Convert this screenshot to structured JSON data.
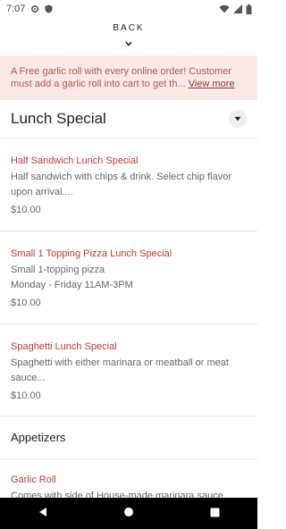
{
  "status": {
    "time": "7:07"
  },
  "header": {
    "back_label": "BACK"
  },
  "promo": {
    "text": "A Free garlic roll with every online order! Customer must add a garlic roll into cart to get th...",
    "more_label": "View more"
  },
  "section": {
    "title": "Lunch Special"
  },
  "items": [
    {
      "name": "Half Sandwich Lunch Special",
      "desc_lines": [
        "Half sandwich with chips & drink. Select chip flavor",
        "upon arrival...."
      ],
      "price": "$10.00"
    },
    {
      "name": "Small 1 Topping Pizza Lunch Special",
      "desc_lines": [
        "Small 1-topping pizza",
        "Monday - Friday 11AM-3PM"
      ],
      "price": "$10.00"
    },
    {
      "name": "Spaghetti Lunch Special",
      "desc_lines": [
        "Spaghetti with either marinara or meatball or meat",
        "sauce..."
      ],
      "price": "$10.00"
    }
  ],
  "category2": {
    "title": "Appetizers"
  },
  "partial_item": {
    "name": "Garlic Roll",
    "desc": "Comes with side of House-made marinara sauce"
  },
  "icons": {
    "status_left": [
      "settings-icon",
      "shield-icon"
    ],
    "status_right": [
      "wifi-icon",
      "signal-icon",
      "battery-icon"
    ],
    "nav": [
      "back-triangle-icon",
      "home-circle-icon",
      "recents-square-icon"
    ]
  },
  "colors": {
    "accent_red": "#c3392b",
    "promo_bg": "#fbe9e7",
    "promo_text": "#b05848"
  }
}
